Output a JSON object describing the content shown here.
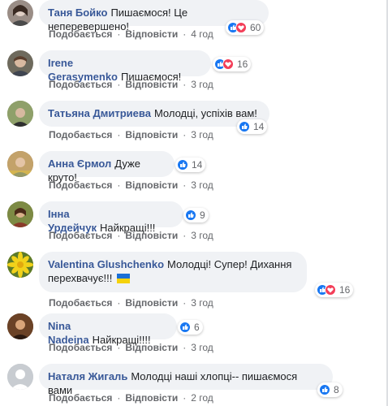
{
  "action_labels": {
    "like": "Подобається",
    "reply": "Відповісти",
    "separator": "·"
  },
  "comments": [
    {
      "author": "Таня Бойко",
      "text": "Пишаємося! Це неперевершено!",
      "reactions": [
        "like",
        "love"
      ],
      "count": "60",
      "time": "4 год",
      "avatar_color": "#9a8d86"
    },
    {
      "author": "Irene Gerasymenko",
      "text": "Пишаємося!",
      "reactions": [
        "like",
        "love"
      ],
      "count": "16",
      "time": "3 год",
      "avatar_color": "#6e6a5d"
    },
    {
      "author": "Татьяна Дмитриева",
      "text": "Молодці, успіхів вам!",
      "reactions": [
        "like"
      ],
      "count": "14",
      "time": "3 год",
      "avatar_color": "#7a8a58"
    },
    {
      "author": "Анна Єрмол",
      "text": "Дуже круто!",
      "reactions": [
        "like"
      ],
      "count": "14",
      "time": "3 год",
      "avatar_color": "#a07a4a"
    },
    {
      "author": "Інна Урдейчук",
      "text": "Найкращі!!!",
      "reactions": [
        "like"
      ],
      "count": "9",
      "time": "3 год",
      "avatar_color": "#6b7a3a"
    },
    {
      "author": "Valentina Glushchenko",
      "text_line1": "Молодці! Супер! Дихання",
      "text_line2": "перехвачує!!!",
      "flag": "ukraine",
      "reactions": [
        "like",
        "love"
      ],
      "count": "16",
      "time": "3 год",
      "avatar_color": "#c9b21a"
    },
    {
      "author": "Nina Nadeina",
      "text": "Найкращі!!!!",
      "reactions": [
        "like"
      ],
      "count": "6",
      "time": "3 год",
      "avatar_color": "#5e3b22"
    },
    {
      "author": "Наталя Жигаль",
      "text": "Молодці наші хлопці-- пишаємося вами",
      "reactions": [
        "like"
      ],
      "count": "8",
      "time": "2 год",
      "avatar_color": "#c8ccd1"
    }
  ],
  "colors": {
    "author": "#385898",
    "bubble": "#f0f2f5",
    "like": "#1877f2",
    "love": "#f33e58",
    "meta": "#65676b"
  },
  "icons": {
    "like": "thumbs-up-icon",
    "love": "heart-icon",
    "flag": "ukraine-flag-icon",
    "default_avatar": "default-avatar-icon"
  }
}
